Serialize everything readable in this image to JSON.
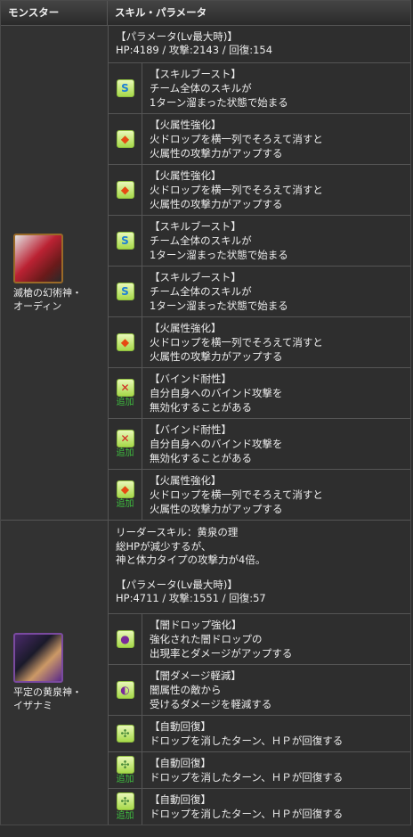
{
  "header": {
    "col1": "モンスター",
    "col2": "スキル・パラメータ"
  },
  "monsters": [
    {
      "name_lines": [
        "滅槍の幻術神・",
        "オーディン"
      ],
      "param_title": "【パラメータ(Lv最大時)】",
      "param_values": "HP:4189 / 攻撃:2143 / 回復:154",
      "awakenings": [
        {
          "icon": "skill-boost-icon",
          "glyph": "S",
          "kind": "skill",
          "add": "",
          "lines": [
            "【スキルブースト】",
            "チーム全体のスキルが",
            "1ターン溜まった状態で始まる"
          ]
        },
        {
          "icon": "fire-enhance-icon",
          "glyph": "◆",
          "kind": "fire",
          "add": "",
          "lines": [
            "【火属性強化】",
            "火ドロップを横一列でそろえて消すと",
            "火属性の攻撃力がアップする"
          ]
        },
        {
          "icon": "fire-enhance-icon",
          "glyph": "◆",
          "kind": "fire",
          "add": "",
          "lines": [
            "【火属性強化】",
            "火ドロップを横一列でそろえて消すと",
            "火属性の攻撃力がアップする"
          ]
        },
        {
          "icon": "skill-boost-icon",
          "glyph": "S",
          "kind": "skill",
          "add": "",
          "lines": [
            "【スキルブースト】",
            "チーム全体のスキルが",
            "1ターン溜まった状態で始まる"
          ]
        },
        {
          "icon": "skill-boost-icon",
          "glyph": "S",
          "kind": "skill",
          "add": "",
          "lines": [
            "【スキルブースト】",
            "チーム全体のスキルが",
            "1ターン溜まった状態で始まる"
          ]
        },
        {
          "icon": "fire-enhance-icon",
          "glyph": "◆",
          "kind": "fire",
          "add": "",
          "lines": [
            "【火属性強化】",
            "火ドロップを横一列でそろえて消すと",
            "火属性の攻撃力がアップする"
          ]
        },
        {
          "icon": "bind-resist-icon",
          "glyph": "✕",
          "kind": "bind",
          "add": "追加",
          "lines": [
            "【バインド耐性】",
            "自分自身へのバインド攻撃を",
            "無効化することがある"
          ]
        },
        {
          "icon": "bind-resist-icon",
          "glyph": "✕",
          "kind": "bind",
          "add": "追加",
          "lines": [
            "【バインド耐性】",
            "自分自身へのバインド攻撃を",
            "無効化することがある"
          ]
        },
        {
          "icon": "fire-enhance-icon",
          "glyph": "◆",
          "kind": "fire",
          "add": "追加",
          "lines": [
            "【火属性強化】",
            "火ドロップを横一列でそろえて消すと",
            "火属性の攻撃力がアップする"
          ]
        }
      ]
    },
    {
      "name_lines": [
        "平定の黄泉神・",
        "イザナミ"
      ],
      "leader_lines": [
        "リーダースキル：黄泉の理",
        "総HPが減少するが、",
        "神と体力タイプの攻撃力が4倍。"
      ],
      "param_title": "【パラメータ(Lv最大時)】",
      "param_values": "HP:4711 / 攻撃:1551 / 回復:57",
      "awakenings": [
        {
          "icon": "dark-drop-enhance-icon",
          "glyph": "●",
          "kind": "dark",
          "add": "",
          "lines": [
            "【闇ドロップ強化】",
            "強化された闇ドロップの",
            "出現率とダメージがアップする"
          ]
        },
        {
          "icon": "dark-damage-reduce-icon",
          "glyph": "◐",
          "kind": "dark",
          "add": "",
          "lines": [
            "【闇ダメージ軽減】",
            "闇属性の敵から",
            "受けるダメージを軽減する"
          ]
        },
        {
          "icon": "auto-recover-icon",
          "glyph": "✣",
          "kind": "heal",
          "add": "",
          "lines": [
            "【自動回復】",
            "ドロップを消したターン、ＨＰが回復する"
          ]
        },
        {
          "icon": "auto-recover-icon",
          "glyph": "✣",
          "kind": "heal",
          "add": "追加",
          "lines": [
            "【自動回復】",
            "ドロップを消したターン、ＨＰが回復する"
          ]
        },
        {
          "icon": "auto-recover-icon",
          "glyph": "✣",
          "kind": "heal",
          "add": "追加",
          "lines": [
            "【自動回復】",
            "ドロップを消したターン、ＨＰが回復する"
          ]
        }
      ]
    }
  ]
}
